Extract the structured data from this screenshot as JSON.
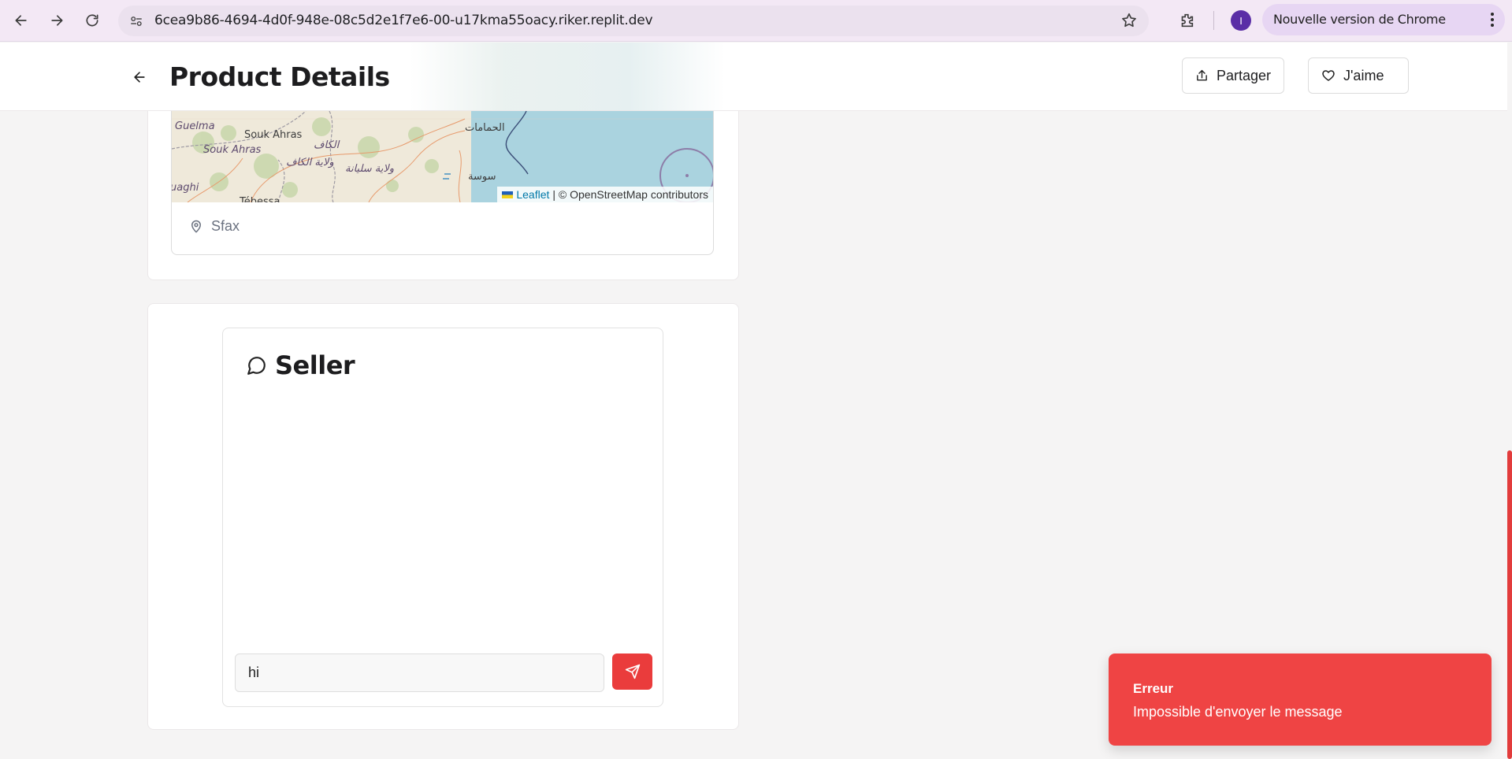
{
  "browser": {
    "url": "6cea9b86-4694-4d0f-948e-08c5d2e1f7e6-00-u17kma55oacy.riker.replit.dev",
    "profile_initial": "I",
    "update_label": "Nouvelle version de Chrome disponible"
  },
  "header": {
    "title": "Product Details",
    "share_label": "Partager",
    "like_label": "J'aime"
  },
  "map": {
    "labels": [
      "Guelma",
      "Souk Ahras",
      "Souk Ahras",
      "الكاف",
      "ولاية الكاف",
      "ولاية سليانة",
      "الحمامات",
      "سوسة",
      "uaghi",
      "Tébessa"
    ],
    "attribution_link": "Leaflet",
    "attribution_text": "| © OpenStreetMap contributors"
  },
  "location": {
    "city": "Sfax"
  },
  "chat": {
    "title": "Seller",
    "input_value": "hi"
  },
  "toast": {
    "title": "Erreur",
    "description": "Impossible d'envoyer le message"
  },
  "colors": {
    "accent": "#ef4444",
    "chrome_bg": "#f3e8f5"
  }
}
